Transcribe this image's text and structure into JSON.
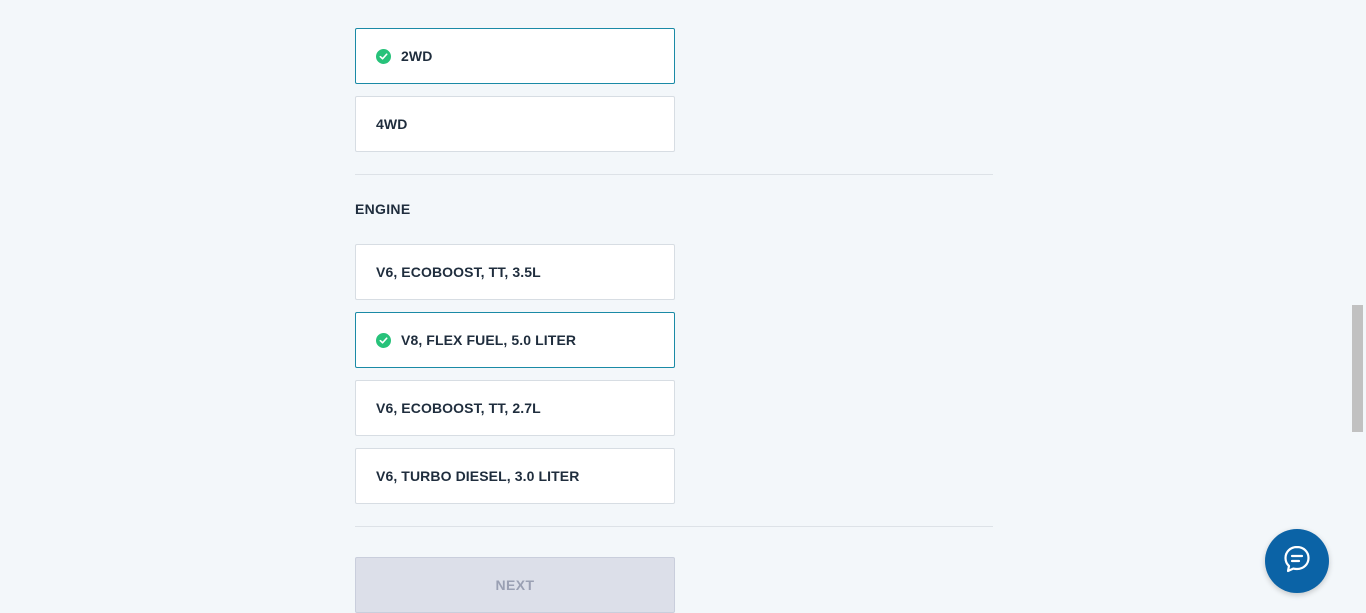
{
  "drive": {
    "options": [
      {
        "label": "2WD",
        "selected": true
      },
      {
        "label": "4WD",
        "selected": false
      }
    ]
  },
  "engine": {
    "title": "ENGINE",
    "options": [
      {
        "label": "V6, ECOBOOST, TT, 3.5L",
        "selected": false
      },
      {
        "label": "V8, FLEX FUEL, 5.0 LITER",
        "selected": true
      },
      {
        "label": "V6, ECOBOOST, TT, 2.7L",
        "selected": false
      },
      {
        "label": "V6, TURBO DIESEL, 3.0 LITER",
        "selected": false
      }
    ]
  },
  "actions": {
    "next_label": "NEXT",
    "next_disabled": true
  },
  "icons": {
    "check": "check-circle-icon",
    "chat": "chat-bubble-icon"
  },
  "colors": {
    "selected_border": "#1a8aa6",
    "check_green": "#27c27a",
    "chat_blue": "#0b63a6",
    "disabled_bg": "#dcdfe9"
  }
}
